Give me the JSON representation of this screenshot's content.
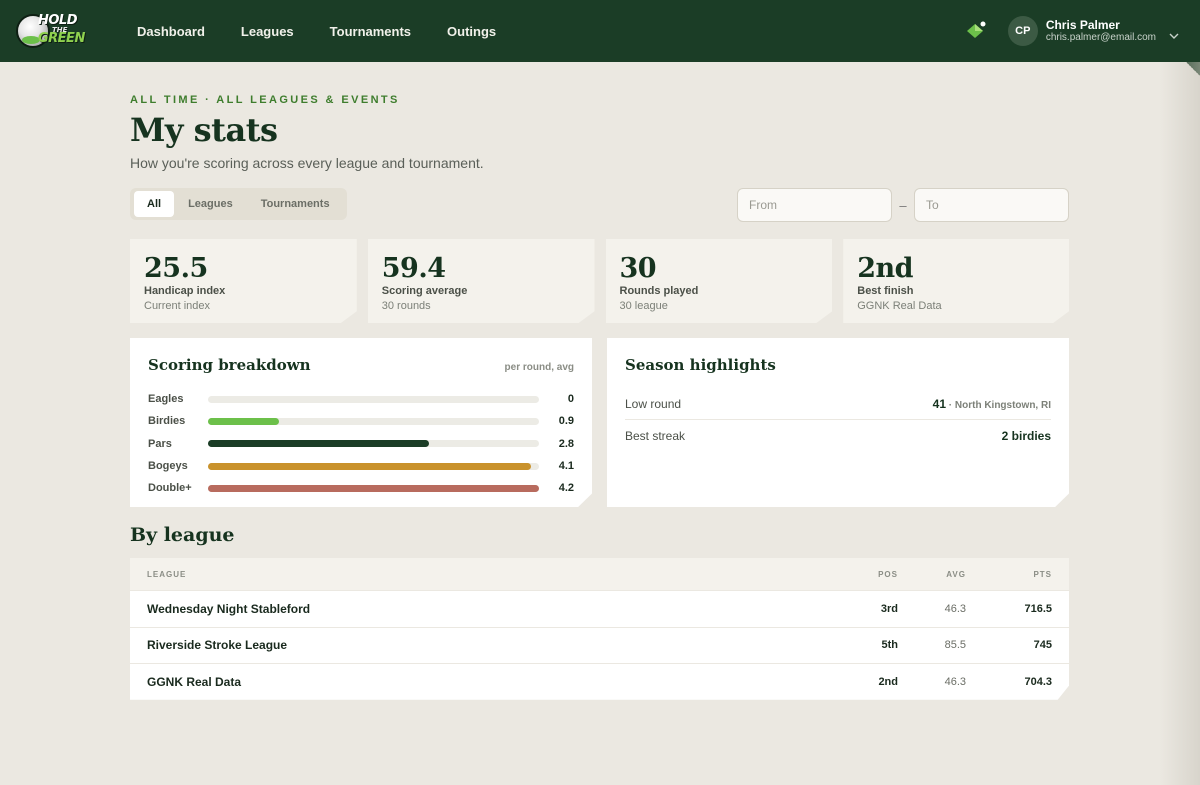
{
  "brand": {
    "logo_line1": "HOLD",
    "logo_line2": "THE",
    "logo_line3": "GREEN"
  },
  "nav": {
    "links": [
      "Dashboard",
      "Leagues",
      "Tournaments",
      "Outings"
    ]
  },
  "user": {
    "initials": "CP",
    "name": "Chris Palmer",
    "email": "chris.palmer@email.com"
  },
  "header": {
    "eyebrow": "ALL TIME · ALL LEAGUES & EVENTS",
    "title": "My stats",
    "subtitle": "How you're scoring across every league and tournament."
  },
  "filters": {
    "segments": [
      "All",
      "Leagues",
      "Tournaments"
    ],
    "active_segment": "All",
    "from_placeholder": "From",
    "to_placeholder": "To",
    "separator": "–"
  },
  "stats": [
    {
      "value": "25.5",
      "label": "Handicap index",
      "sub": "Current index"
    },
    {
      "value": "59.4",
      "label": "Scoring average",
      "sub": "30 rounds"
    },
    {
      "value": "30",
      "label": "Rounds played",
      "sub": "30 league"
    },
    {
      "value": "2nd",
      "label": "Best finish",
      "sub": "GGNK Real Data"
    }
  ],
  "breakdown": {
    "title": "Scoring breakdown",
    "note": "per round, avg",
    "max": 4.2,
    "rows": [
      {
        "label": "Eagles",
        "value": "0",
        "amount": 0,
        "color": "#1b3d26"
      },
      {
        "label": "Birdies",
        "value": "0.9",
        "amount": 0.9,
        "color": "#6cc04a"
      },
      {
        "label": "Pars",
        "value": "2.8",
        "amount": 2.8,
        "color": "#1b3d26"
      },
      {
        "label": "Bogeys",
        "value": "4.1",
        "amount": 4.1,
        "color": "#c9922c"
      },
      {
        "label": "Double+",
        "value": "4.2",
        "amount": 4.2,
        "color": "#b86b5e"
      }
    ]
  },
  "highlights": {
    "title": "Season highlights",
    "low_round_label": "Low round",
    "low_round_value": "41",
    "low_round_extra": " · North Kingstown, RI",
    "best_streak_label": "Best streak",
    "best_streak_value": "2 birdies"
  },
  "by_league": {
    "title": "By league",
    "columns": {
      "league": "LEAGUE",
      "pos": "POS",
      "avg": "AVG",
      "pts": "PTS"
    },
    "rows": [
      {
        "name": "Wednesday Night Stableford",
        "pos": "3rd",
        "avg": "46.3",
        "pts": "716.5"
      },
      {
        "name": "Riverside Stroke League",
        "pos": "5th",
        "avg": "85.5",
        "pts": "745"
      },
      {
        "name": "GGNK Real Data",
        "pos": "2nd",
        "avg": "46.3",
        "pts": "704.3"
      }
    ]
  },
  "colors": {
    "nav_bg": "#1b3d26",
    "accent_green": "#3e7d2d",
    "page_bg": "#ebe8e1"
  },
  "icons": {
    "gem": "gem-icon",
    "chevron": "chevron-down-icon"
  }
}
